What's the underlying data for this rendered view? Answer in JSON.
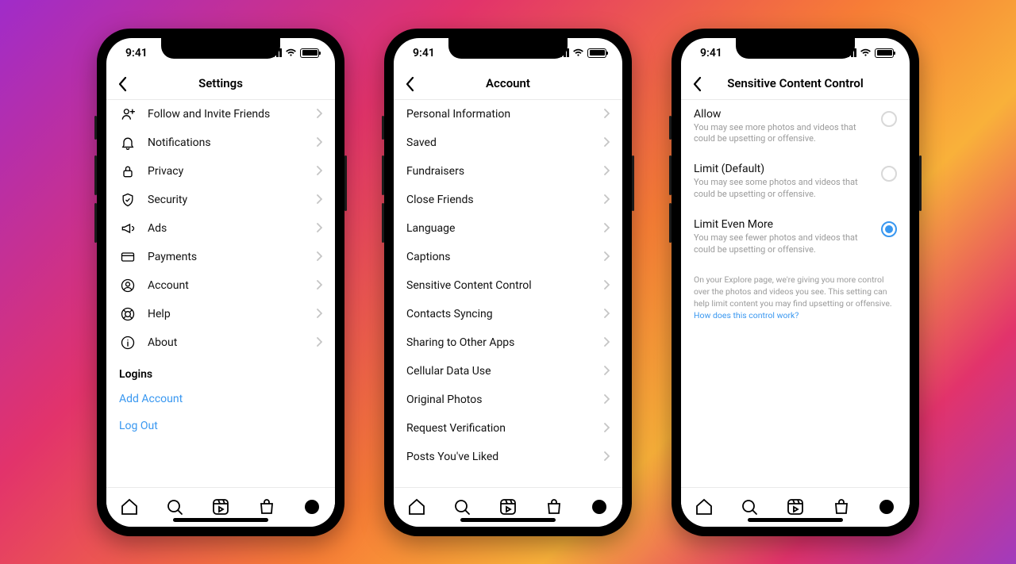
{
  "status": {
    "time": "9:41"
  },
  "phones": [
    {
      "title": "Settings",
      "items": [
        {
          "icon": "invite",
          "label": "Follow and Invite Friends"
        },
        {
          "icon": "bell",
          "label": "Notifications"
        },
        {
          "icon": "lock",
          "label": "Privacy"
        },
        {
          "icon": "shield",
          "label": "Security"
        },
        {
          "icon": "megaphone",
          "label": "Ads"
        },
        {
          "icon": "card",
          "label": "Payments"
        },
        {
          "icon": "user",
          "label": "Account"
        },
        {
          "icon": "lifebuoy",
          "label": "Help"
        },
        {
          "icon": "info",
          "label": "About"
        }
      ],
      "section": "Logins",
      "links": [
        "Add Account",
        "Log Out"
      ]
    },
    {
      "title": "Account",
      "items": [
        {
          "label": "Personal Information"
        },
        {
          "label": "Saved"
        },
        {
          "label": "Fundraisers"
        },
        {
          "label": "Close Friends"
        },
        {
          "label": "Language"
        },
        {
          "label": "Captions"
        },
        {
          "label": "Sensitive Content Control"
        },
        {
          "label": "Contacts Syncing"
        },
        {
          "label": "Sharing to Other Apps"
        },
        {
          "label": "Cellular Data Use"
        },
        {
          "label": "Original Photos"
        },
        {
          "label": "Request Verification"
        },
        {
          "label": "Posts You've Liked"
        }
      ]
    },
    {
      "title": "Sensitive Content Control",
      "options": [
        {
          "title": "Allow",
          "desc": "You may see more photos and videos that could be upsetting or offensive.",
          "selected": false
        },
        {
          "title": "Limit (Default)",
          "desc": "You may see some photos and videos that could be upsetting or offensive.",
          "selected": false
        },
        {
          "title": "Limit Even More",
          "desc": "You may see fewer photos and videos that could be upsetting or offensive.",
          "selected": true
        }
      ],
      "footnote": "On your Explore page, we're giving you more control over the photos and videos you see. This setting can help limit content you may find upsetting or offensive.",
      "footnote_link": "How does this control work?"
    }
  ]
}
